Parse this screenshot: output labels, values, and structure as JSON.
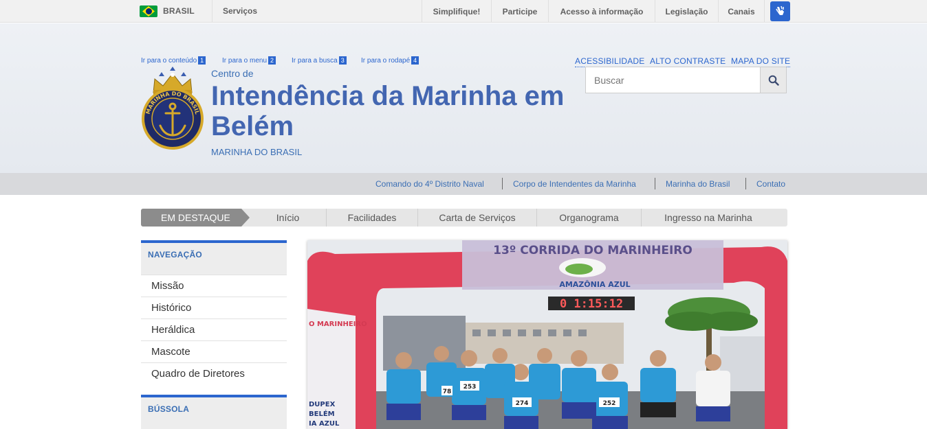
{
  "barra": {
    "country": "BRASIL",
    "services": "Serviços",
    "menu": [
      "Simplifique!",
      "Participe",
      "Acesso à informação",
      "Legislação",
      "Canais"
    ]
  },
  "skip_links": [
    {
      "label": "Ir para o conteúdo",
      "num": "1"
    },
    {
      "label": "Ir para o menu",
      "num": "2"
    },
    {
      "label": "Ir para a busca",
      "num": "3"
    },
    {
      "label": "Ir para o rodapé",
      "num": "4"
    }
  ],
  "accessibility": [
    "ACESSIBILIDADE",
    "ALTO CONTRASTE",
    "MAPA DO SITE"
  ],
  "header": {
    "pre_title": "Centro de",
    "title": "Intendência da Marinha em Belém",
    "subtitle": "MARINHA DO BRASIL",
    "logo_text": "MARINHA DO BRASIL"
  },
  "search": {
    "placeholder": "Buscar"
  },
  "service_links": [
    "Comando do 4º Distrito Naval",
    "Corpo de Intendentes da Marinha",
    "Marinha do Brasil",
    "Contato"
  ],
  "tabs": {
    "featured": "EM DESTAQUE",
    "items": [
      "Início",
      "Facilidades",
      "Carta de Serviços",
      "Organograma",
      "Ingresso na Marinha"
    ]
  },
  "sidebar": {
    "nav_heading": "NAVEGAÇÃO",
    "items": [
      "Missão",
      "Histórico",
      "Heráldica",
      "Mascote",
      "Quadro de Diretores"
    ],
    "second_heading": "BÚSSOLA"
  },
  "photo": {
    "banner": "13º CORRIDA DO MARINHEIRO",
    "sponsor": "AMAZÔNIA AZUL",
    "timer": "0 1:15:12",
    "bib_numbers": [
      "253",
      "274",
      "252",
      "78"
    ],
    "side_banner": "O MARINHEIRO",
    "side_text": [
      "DUPEX",
      "BELÉM",
      "IA AZUL"
    ]
  },
  "colors": {
    "accent": "#2c66ce",
    "title": "#4366b1",
    "arch": "#e0425a"
  },
  "icons": {
    "search": "magnifier-icon",
    "libras": "hands-icon"
  }
}
